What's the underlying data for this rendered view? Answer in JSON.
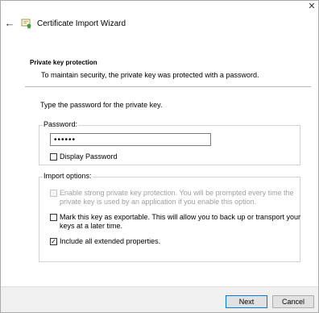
{
  "window": {
    "title": "Certificate Import Wizard",
    "close_glyph": "✕",
    "back_glyph": "←"
  },
  "page": {
    "heading": "Private key protection",
    "subheading": "To maintain security, the private key was protected with a password.",
    "instruction": "Type the password for the private key."
  },
  "password": {
    "label": "Password:",
    "value": "••••••",
    "display_password": {
      "label": "Display Password",
      "checked": false
    }
  },
  "import_options": {
    "label": "Import options:",
    "options": [
      {
        "label_line1": "Enable strong private key protection. You will be prompted every time the",
        "label_line2": "private key is used by an application if you enable this option.",
        "checked": false,
        "enabled": false
      },
      {
        "label_line1": "Mark this key as exportable. This will allow you to back up or transport your",
        "label_line2": "keys at a later time.",
        "checked": false,
        "enabled": true
      },
      {
        "label_line1": "Include all extended properties.",
        "checked": true,
        "enabled": true
      }
    ]
  },
  "buttons": {
    "next": "Next",
    "cancel": "Cancel"
  },
  "check_glyph": "✓"
}
